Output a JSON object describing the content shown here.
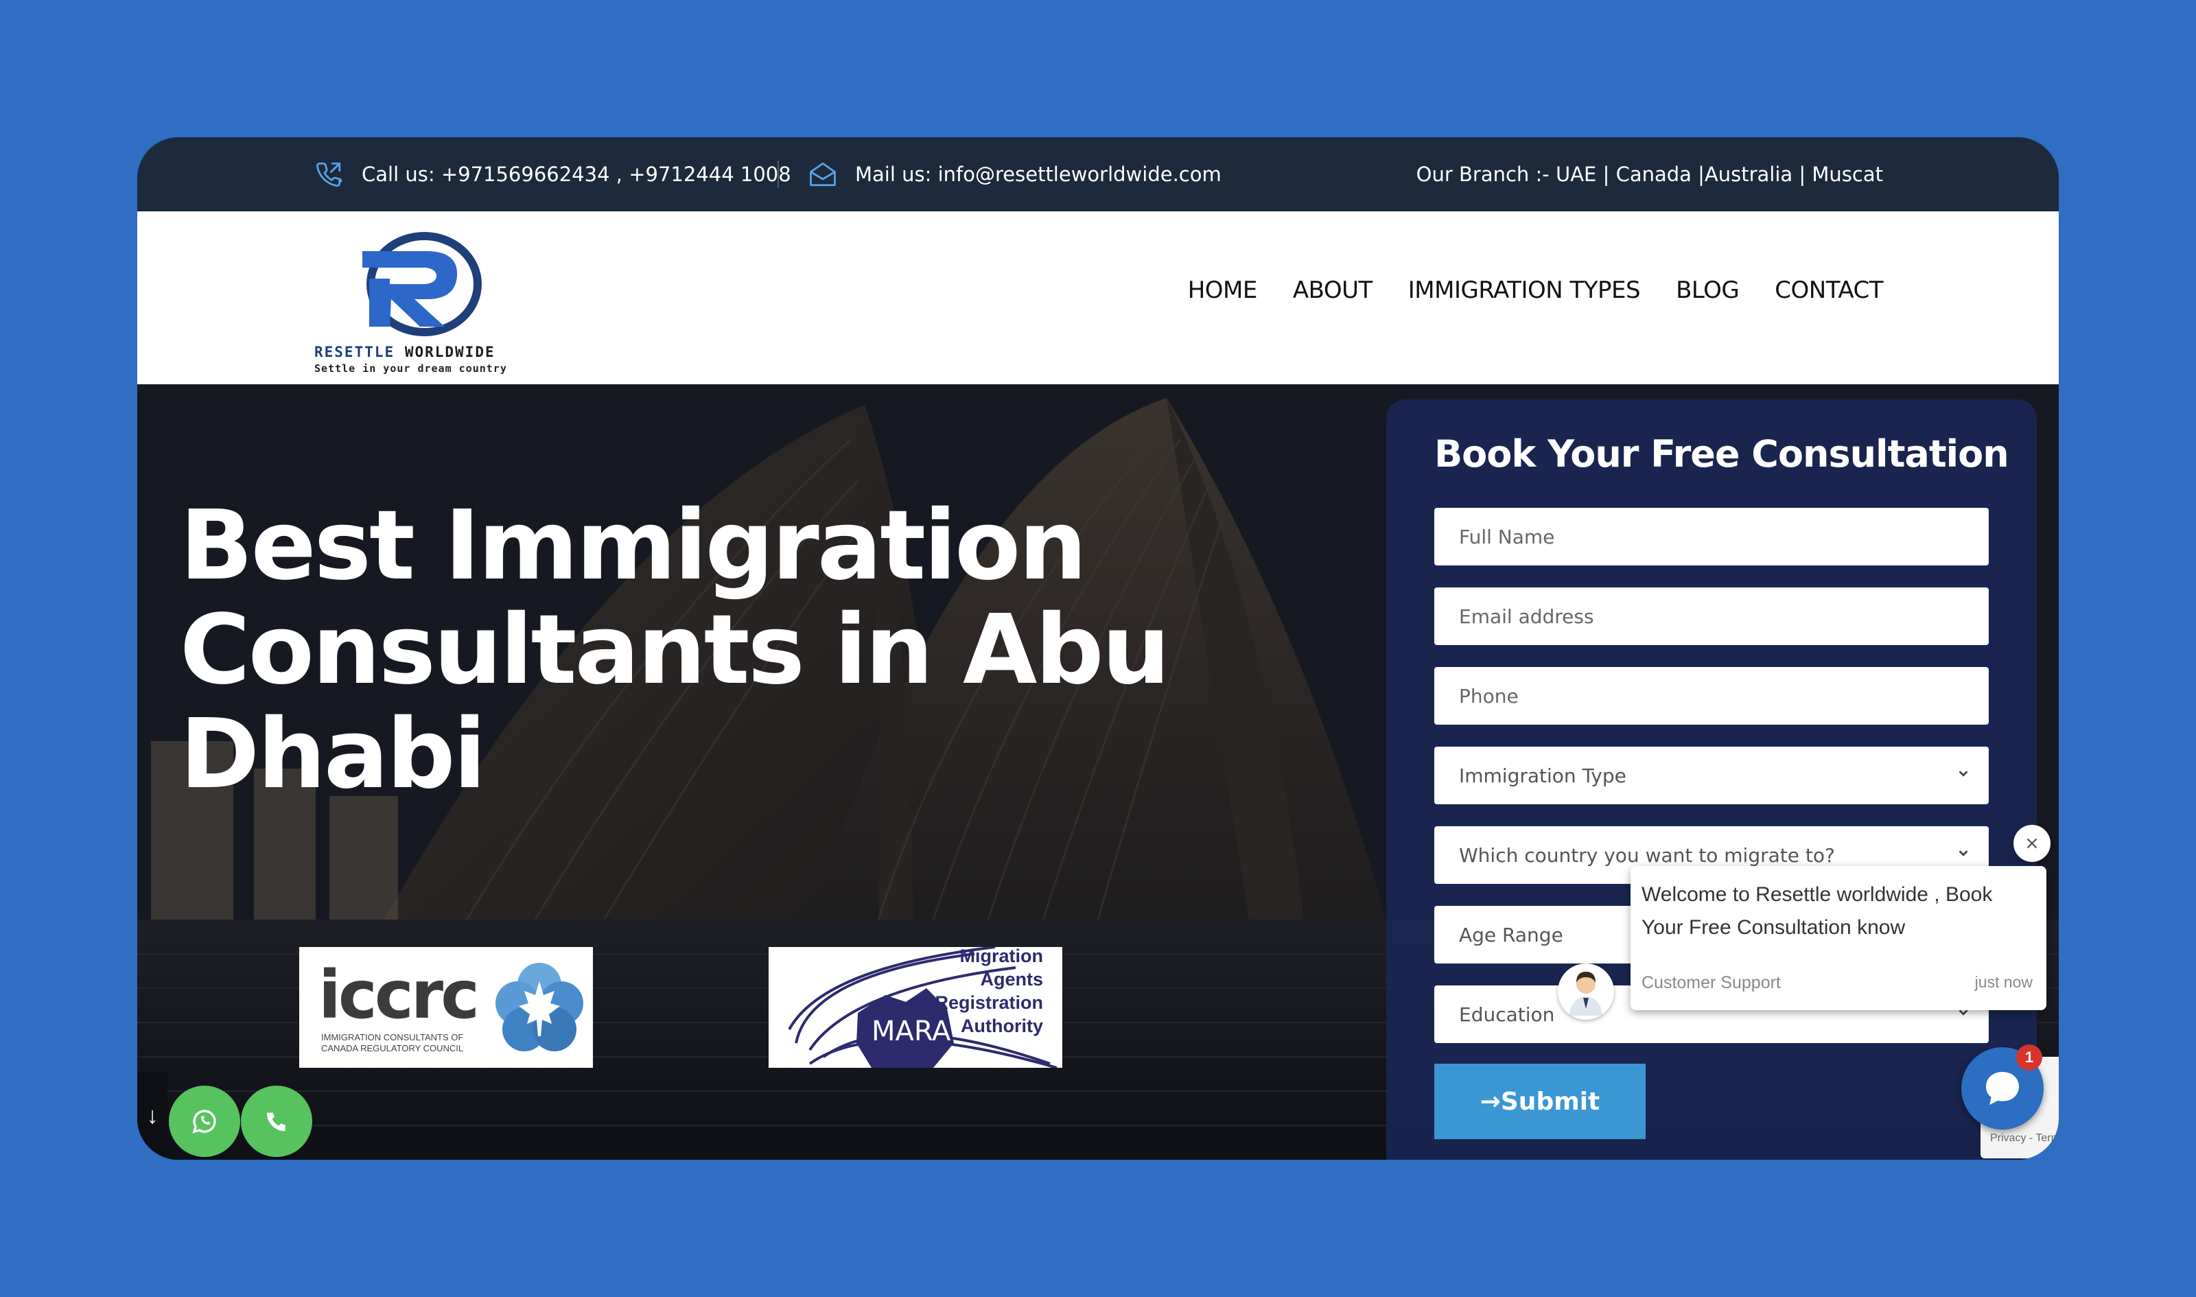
{
  "topbar": {
    "call_text": "Call us: +971569662434 , +9712444 1008",
    "mail_text": "Mail us: info@resettleworldwide.com",
    "branch_text": "Our Branch :- UAE | Canada |Australia | Muscat"
  },
  "logo": {
    "name_part1": "RESETTLE",
    "name_part2": "WORLDWIDE",
    "tagline": "Settle in your dream country"
  },
  "nav": {
    "items": [
      "HOME",
      "ABOUT",
      "IMMIGRATION TYPES",
      "BLOG",
      "CONTACT"
    ]
  },
  "hero": {
    "title": "Best Immigration Consultants in Abu Dhabi"
  },
  "badges": {
    "iccrc_word": "iccrc",
    "iccrc_sub": "IMMIGRATION CONSULTANTS OF CANADA REGULATORY COUNCIL",
    "mara_lines": [
      "Migration",
      "Agents",
      "Registration",
      "Authority"
    ],
    "mara_word": "MARA"
  },
  "scroll": {
    "arrow": "↓"
  },
  "form": {
    "title": "Book Your Free Consultation",
    "full_name_placeholder": "Full Name",
    "email_placeholder": "Email address",
    "phone_placeholder": "Phone",
    "immigration_type": "Immigration Type",
    "country": "Which country you want to migrate to?",
    "age_range": "Age Range",
    "education": "Education",
    "submit_label": "→Submit"
  },
  "chat": {
    "message": "Welcome to Resettle worldwide , Book Your Free Consultation know",
    "agent": "Customer Support",
    "time": "just now",
    "unread_count": "1",
    "recaptcha_text": "Privacy - Terms"
  },
  "colors": {
    "page_bg": "#2f6ec2",
    "topbar_bg": "#1c2a3c",
    "form_panel": "#1a2654",
    "submit": "#3b97d3",
    "whatsapp_green": "#57c35f",
    "chat_launcher": "#2b6ec2",
    "badge_red": "#d8332b"
  },
  "icons": {
    "call": "phone-icon",
    "mail": "envelope-icon",
    "whatsapp": "whatsapp-icon",
    "phone_fab": "phone-icon",
    "chat": "chat-bubble-icon",
    "close": "close-icon",
    "select": "chevron-down-icon"
  }
}
